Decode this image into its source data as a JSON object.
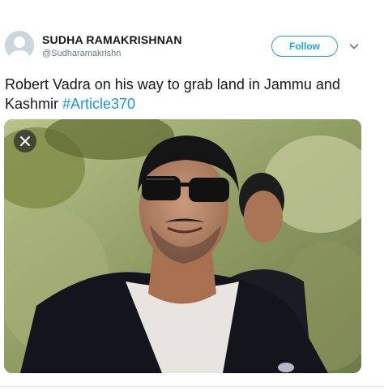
{
  "tweet": {
    "author_name": "SUDHA RAMAKRISHNAN",
    "author_handle": "@Sudharamakrishn",
    "follow_label": "Follow",
    "text": "Robert Vadra on his way to grab land in Jammu and Kashmir ",
    "hashtag": "#Article370",
    "icons": {
      "avatar": "default-avatar-icon",
      "menu": "chevron-down-icon",
      "close": "close-icon"
    }
  },
  "colors": {
    "accent": "#1da1f2",
    "hashtag": "#1b95e0",
    "secondary_text": "#657786"
  }
}
